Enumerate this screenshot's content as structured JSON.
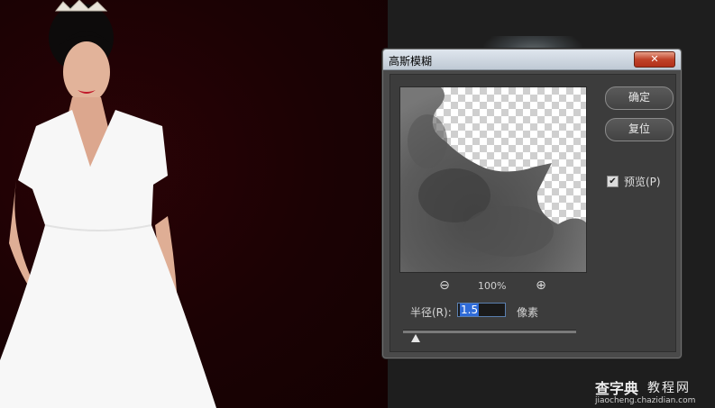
{
  "dialog": {
    "title": "高斯模糊",
    "close_icon": "close-icon",
    "ok_label": "确定",
    "reset_label": "复位",
    "preview_label": "预览(P)",
    "preview_checked": true,
    "zoom_level": "100%",
    "radius_label": "半径(R):",
    "radius_value": "1.5",
    "radius_unit": "像素"
  },
  "watermark": {
    "brand": "查字典",
    "category": "教程网",
    "url": "jiaocheng.chazidian.com"
  }
}
